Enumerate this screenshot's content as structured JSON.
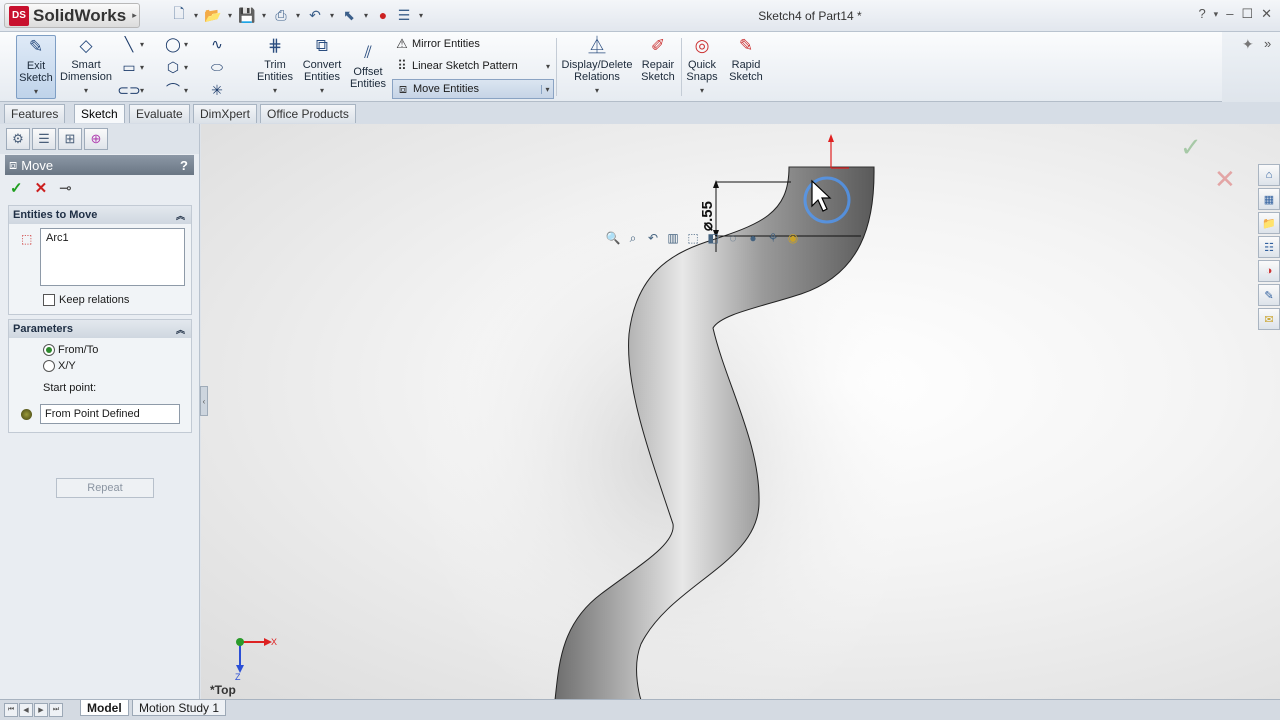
{
  "app": {
    "brand": "SolidWorks",
    "brand_badge": "DS",
    "window_title": "Sketch4 of Part14 *"
  },
  "ribbon": {
    "exit_sketch": "Exit Sketch",
    "smart_dimension": "Smart Dimension",
    "trim_entities": "Trim Entities",
    "convert_entities": "Convert Entities",
    "offset_entities": "Offset Entities",
    "mirror_entities": "Mirror Entities",
    "linear_sketch_pattern": "Linear Sketch Pattern",
    "move_entities": "Move Entities",
    "display_delete_relations": "Display/Delete Relations",
    "repair_sketch": "Repair Sketch",
    "quick_snaps": "Quick Snaps",
    "rapid_sketch": "Rapid Sketch"
  },
  "tabs": [
    {
      "label": "Features"
    },
    {
      "label": "Sketch"
    },
    {
      "label": "Evaluate"
    },
    {
      "label": "DimXpert"
    },
    {
      "label": "Office Products"
    }
  ],
  "active_tab": "Sketch",
  "property_manager": {
    "title": "Move",
    "help": "?",
    "entities_group": {
      "title": "Entities to Move",
      "items": [
        "Arc1"
      ],
      "keep_relations_label": "Keep relations",
      "keep_relations_checked": false
    },
    "parameters_group": {
      "title": "Parameters",
      "option_from_to": "From/To",
      "option_xy": "X/Y",
      "selected_option": "From/To",
      "start_point_label": "Start point:",
      "start_point_value": "From Point Defined"
    },
    "repeat_label": "Repeat"
  },
  "graphics": {
    "dimension_text": "⌀.55",
    "view_label": "*Top",
    "triad_x": "X",
    "triad_y": "Z"
  },
  "bottom_tabs": [
    {
      "label": "Model"
    },
    {
      "label": "Motion Study 1"
    }
  ],
  "colors": {
    "accent": "#3b6fb0",
    "ok_green": "#1e9e1e",
    "cancel_red": "#cc1f1f",
    "highlight_circle": "#5aa0ff"
  }
}
